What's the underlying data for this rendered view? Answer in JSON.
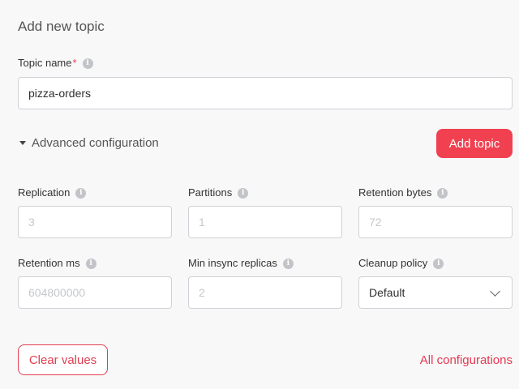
{
  "title": "Add new topic",
  "topic_name": {
    "label": "Topic name",
    "required_mark": "*",
    "value": "pizza-orders"
  },
  "advanced": {
    "label": "Advanced configuration"
  },
  "add_button": "Add topic",
  "fields": {
    "replication": {
      "label": "Replication",
      "placeholder": "3"
    },
    "partitions": {
      "label": "Partitions",
      "placeholder": "1"
    },
    "retention_bytes": {
      "label": "Retention bytes",
      "placeholder": "72"
    },
    "retention_ms": {
      "label": "Retention ms",
      "placeholder": "604800000"
    },
    "min_insync": {
      "label": "Min insync replicas",
      "placeholder": "2"
    },
    "cleanup": {
      "label": "Cleanup policy",
      "value": "Default"
    }
  },
  "clear_button": "Clear values",
  "all_configs_link": "All configurations",
  "info_glyph": "i",
  "colors": {
    "accent": "#f1404f",
    "border": "#cfd2d6",
    "background": "#f8f8f9"
  }
}
